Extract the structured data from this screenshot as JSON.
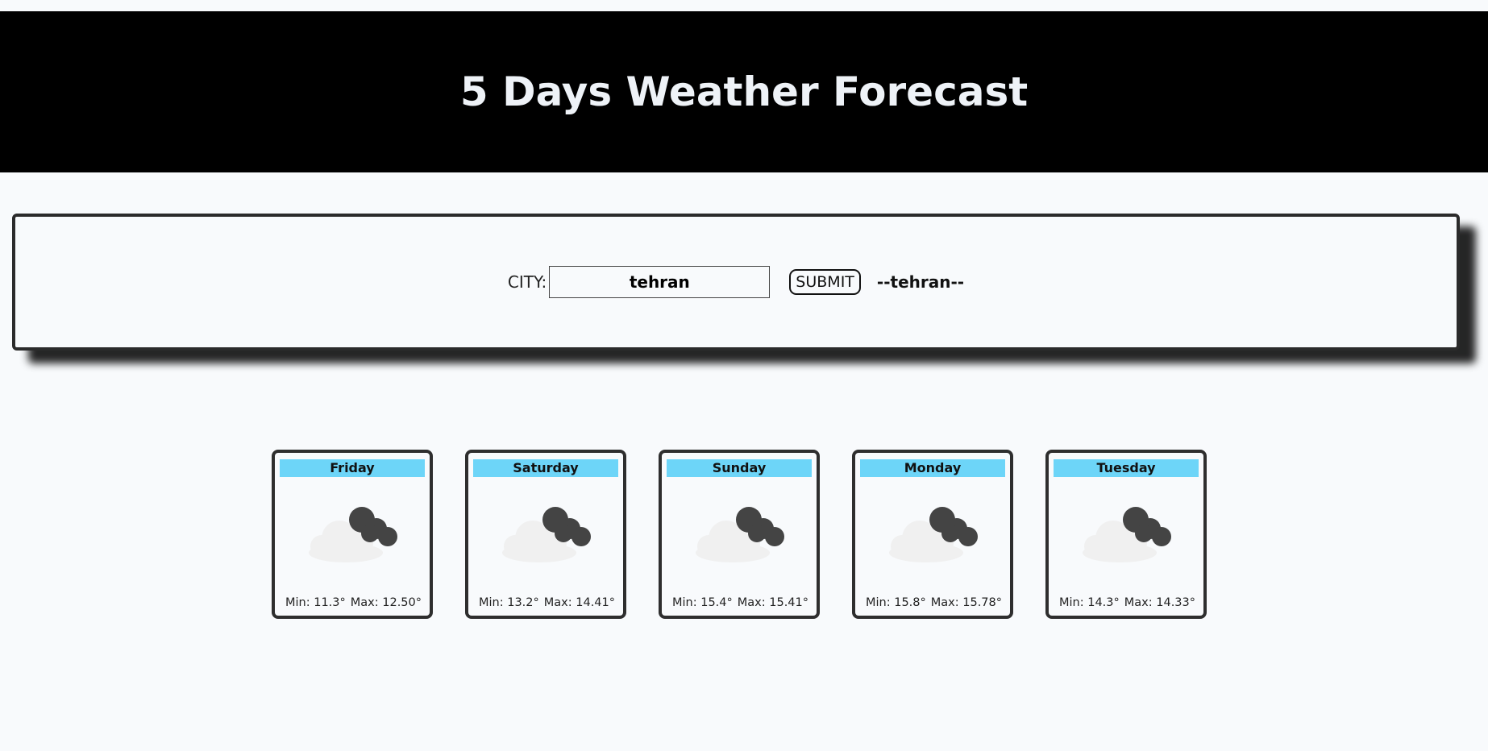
{
  "header": {
    "title": "5 Days Weather Forecast"
  },
  "search": {
    "city_label": "CITY:",
    "city_value": "tehran",
    "submit_label": "SUBMIT",
    "result_city": "--tehran--"
  },
  "forecast": [
    {
      "day": "Friday",
      "icon": "cloudy-icon",
      "min": "Min: 11.3°",
      "max": "Max: 12.50°"
    },
    {
      "day": "Saturday",
      "icon": "cloudy-icon",
      "min": "Min: 13.2°",
      "max": "Max: 14.41°"
    },
    {
      "day": "Sunday",
      "icon": "cloudy-icon",
      "min": "Min: 15.4°",
      "max": "Max: 15.41°"
    },
    {
      "day": "Monday",
      "icon": "cloudy-icon",
      "min": "Min: 15.8°",
      "max": "Max: 15.78°"
    },
    {
      "day": "Tuesday",
      "icon": "cloudy-icon",
      "min": "Min: 14.3°",
      "max": "Max: 14.33°"
    }
  ],
  "colors": {
    "header_bg": "#000000",
    "day_bar": "#6dd5f8",
    "card_border": "#2e2e2e"
  }
}
